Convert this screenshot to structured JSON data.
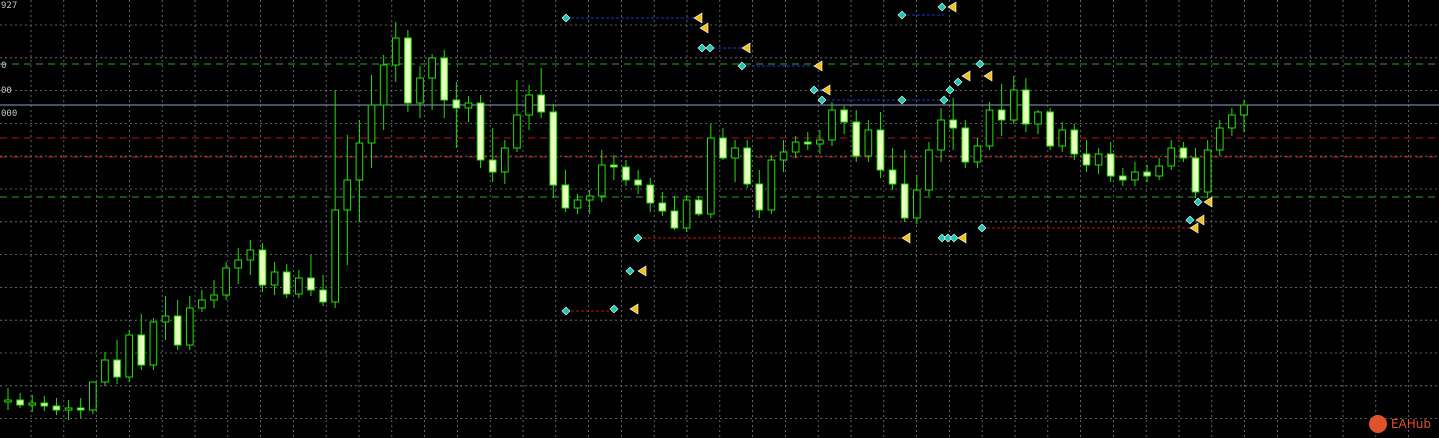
{
  "colors": {
    "background": "#000000",
    "grid": "#7c7c7c",
    "bull": "#22e000",
    "bull_body": "#000000",
    "bear_body": "#e8ffc0",
    "wick": "#22e000",
    "current_line": "#8aa0c8",
    "green_dash": "#2aa02a",
    "red_dash": "#b41414",
    "blue_arrow_line": "#2030d0",
    "red_arrow_line": "#c01010",
    "marker_buy": "#18c8b0",
    "marker_sell": "#f0c020",
    "watermark": "#e0522b"
  },
  "price_labels": [
    "927",
    "0",
    "00",
    "000"
  ],
  "watermark": {
    "text": "EAHub"
  },
  "chart_data": {
    "type": "candlestick",
    "ylim": [
      0,
      438
    ],
    "levels": {
      "current": 105,
      "green_dashed": [
        64,
        197
      ],
      "red_dashed": [
        138,
        157
      ]
    },
    "candles": [
      {
        "o": 402,
        "h": 388,
        "l": 410,
        "c": 400
      },
      {
        "o": 400,
        "h": 393,
        "l": 408,
        "c": 405
      },
      {
        "o": 405,
        "h": 395,
        "l": 412,
        "c": 403
      },
      {
        "o": 403,
        "h": 396,
        "l": 411,
        "c": 406
      },
      {
        "o": 406,
        "h": 398,
        "l": 415,
        "c": 410
      },
      {
        "o": 410,
        "h": 400,
        "l": 420,
        "c": 408
      },
      {
        "o": 408,
        "h": 398,
        "l": 418,
        "c": 410
      },
      {
        "o": 410,
        "h": 394,
        "l": 414,
        "c": 382
      },
      {
        "o": 382,
        "h": 352,
        "l": 386,
        "c": 360
      },
      {
        "o": 360,
        "h": 340,
        "l": 384,
        "c": 377
      },
      {
        "o": 377,
        "h": 330,
        "l": 382,
        "c": 335
      },
      {
        "o": 335,
        "h": 314,
        "l": 370,
        "c": 365
      },
      {
        "o": 365,
        "h": 318,
        "l": 370,
        "c": 322
      },
      {
        "o": 322,
        "h": 296,
        "l": 340,
        "c": 316
      },
      {
        "o": 316,
        "h": 300,
        "l": 350,
        "c": 345
      },
      {
        "o": 345,
        "h": 296,
        "l": 350,
        "c": 308
      },
      {
        "o": 308,
        "h": 290,
        "l": 312,
        "c": 300
      },
      {
        "o": 300,
        "h": 280,
        "l": 308,
        "c": 295
      },
      {
        "o": 295,
        "h": 262,
        "l": 300,
        "c": 268
      },
      {
        "o": 268,
        "h": 248,
        "l": 284,
        "c": 260
      },
      {
        "o": 260,
        "h": 240,
        "l": 275,
        "c": 250
      },
      {
        "o": 250,
        "h": 243,
        "l": 292,
        "c": 285
      },
      {
        "o": 285,
        "h": 262,
        "l": 295,
        "c": 272
      },
      {
        "o": 272,
        "h": 264,
        "l": 298,
        "c": 294
      },
      {
        "o": 294,
        "h": 270,
        "l": 298,
        "c": 278
      },
      {
        "o": 278,
        "h": 255,
        "l": 296,
        "c": 290
      },
      {
        "o": 290,
        "h": 275,
        "l": 306,
        "c": 302
      },
      {
        "o": 302,
        "h": 90,
        "l": 308,
        "c": 210
      },
      {
        "o": 210,
        "h": 135,
        "l": 265,
        "c": 180
      },
      {
        "o": 180,
        "h": 120,
        "l": 222,
        "c": 143
      },
      {
        "o": 143,
        "h": 75,
        "l": 168,
        "c": 105
      },
      {
        "o": 105,
        "h": 55,
        "l": 130,
        "c": 65
      },
      {
        "o": 65,
        "h": 22,
        "l": 82,
        "c": 38
      },
      {
        "o": 38,
        "h": 30,
        "l": 112,
        "c": 103
      },
      {
        "o": 103,
        "h": 66,
        "l": 118,
        "c": 78
      },
      {
        "o": 78,
        "h": 54,
        "l": 110,
        "c": 58
      },
      {
        "o": 58,
        "h": 50,
        "l": 118,
        "c": 100
      },
      {
        "o": 100,
        "h": 82,
        "l": 148,
        "c": 108
      },
      {
        "o": 108,
        "h": 96,
        "l": 122,
        "c": 103
      },
      {
        "o": 103,
        "h": 95,
        "l": 168,
        "c": 160
      },
      {
        "o": 160,
        "h": 128,
        "l": 182,
        "c": 172
      },
      {
        "o": 172,
        "h": 140,
        "l": 184,
        "c": 148
      },
      {
        "o": 148,
        "h": 80,
        "l": 152,
        "c": 115
      },
      {
        "o": 115,
        "h": 85,
        "l": 130,
        "c": 95
      },
      {
        "o": 95,
        "h": 68,
        "l": 118,
        "c": 112
      },
      {
        "o": 112,
        "h": 104,
        "l": 198,
        "c": 185
      },
      {
        "o": 185,
        "h": 170,
        "l": 212,
        "c": 208
      },
      {
        "o": 208,
        "h": 194,
        "l": 214,
        "c": 200
      },
      {
        "o": 200,
        "h": 190,
        "l": 214,
        "c": 196
      },
      {
        "o": 196,
        "h": 150,
        "l": 202,
        "c": 165
      },
      {
        "o": 165,
        "h": 155,
        "l": 180,
        "c": 167
      },
      {
        "o": 167,
        "h": 160,
        "l": 186,
        "c": 180
      },
      {
        "o": 180,
        "h": 170,
        "l": 194,
        "c": 185
      },
      {
        "o": 185,
        "h": 178,
        "l": 212,
        "c": 203
      },
      {
        "o": 203,
        "h": 192,
        "l": 216,
        "c": 211
      },
      {
        "o": 211,
        "h": 196,
        "l": 230,
        "c": 228
      },
      {
        "o": 228,
        "h": 195,
        "l": 232,
        "c": 200
      },
      {
        "o": 200,
        "h": 196,
        "l": 216,
        "c": 214
      },
      {
        "o": 214,
        "h": 124,
        "l": 218,
        "c": 138
      },
      {
        "o": 138,
        "h": 128,
        "l": 160,
        "c": 158
      },
      {
        "o": 158,
        "h": 140,
        "l": 182,
        "c": 148
      },
      {
        "o": 148,
        "h": 140,
        "l": 188,
        "c": 184
      },
      {
        "o": 184,
        "h": 170,
        "l": 218,
        "c": 210
      },
      {
        "o": 210,
        "h": 155,
        "l": 214,
        "c": 160
      },
      {
        "o": 160,
        "h": 140,
        "l": 172,
        "c": 152
      },
      {
        "o": 152,
        "h": 136,
        "l": 158,
        "c": 142
      },
      {
        "o": 142,
        "h": 132,
        "l": 150,
        "c": 144
      },
      {
        "o": 144,
        "h": 130,
        "l": 154,
        "c": 140
      },
      {
        "o": 140,
        "h": 102,
        "l": 146,
        "c": 110
      },
      {
        "o": 110,
        "h": 106,
        "l": 134,
        "c": 122
      },
      {
        "o": 122,
        "h": 110,
        "l": 162,
        "c": 156
      },
      {
        "o": 156,
        "h": 120,
        "l": 162,
        "c": 130
      },
      {
        "o": 130,
        "h": 112,
        "l": 178,
        "c": 170
      },
      {
        "o": 170,
        "h": 148,
        "l": 190,
        "c": 184
      },
      {
        "o": 184,
        "h": 150,
        "l": 222,
        "c": 218
      },
      {
        "o": 218,
        "h": 175,
        "l": 224,
        "c": 190
      },
      {
        "o": 190,
        "h": 142,
        "l": 196,
        "c": 150
      },
      {
        "o": 150,
        "h": 108,
        "l": 162,
        "c": 120
      },
      {
        "o": 120,
        "h": 98,
        "l": 150,
        "c": 128
      },
      {
        "o": 128,
        "h": 120,
        "l": 168,
        "c": 162
      },
      {
        "o": 162,
        "h": 138,
        "l": 168,
        "c": 146
      },
      {
        "o": 146,
        "h": 102,
        "l": 150,
        "c": 110
      },
      {
        "o": 110,
        "h": 84,
        "l": 136,
        "c": 120
      },
      {
        "o": 120,
        "h": 76,
        "l": 124,
        "c": 90
      },
      {
        "o": 90,
        "h": 78,
        "l": 132,
        "c": 124
      },
      {
        "o": 124,
        "h": 110,
        "l": 134,
        "c": 112
      },
      {
        "o": 112,
        "h": 108,
        "l": 150,
        "c": 146
      },
      {
        "o": 146,
        "h": 122,
        "l": 152,
        "c": 130
      },
      {
        "o": 130,
        "h": 124,
        "l": 160,
        "c": 154
      },
      {
        "o": 154,
        "h": 140,
        "l": 172,
        "c": 165
      },
      {
        "o": 165,
        "h": 148,
        "l": 174,
        "c": 154
      },
      {
        "o": 154,
        "h": 142,
        "l": 182,
        "c": 176
      },
      {
        "o": 176,
        "h": 168,
        "l": 186,
        "c": 180
      },
      {
        "o": 180,
        "h": 162,
        "l": 186,
        "c": 172
      },
      {
        "o": 172,
        "h": 165,
        "l": 182,
        "c": 176
      },
      {
        "o": 176,
        "h": 158,
        "l": 180,
        "c": 166
      },
      {
        "o": 166,
        "h": 140,
        "l": 170,
        "c": 148
      },
      {
        "o": 148,
        "h": 142,
        "l": 162,
        "c": 158
      },
      {
        "o": 158,
        "h": 148,
        "l": 198,
        "c": 192
      },
      {
        "o": 192,
        "h": 140,
        "l": 198,
        "c": 150
      },
      {
        "o": 150,
        "h": 120,
        "l": 156,
        "c": 128
      },
      {
        "o": 128,
        "h": 108,
        "l": 136,
        "c": 115
      },
      {
        "o": 115,
        "h": 100,
        "l": 132,
        "c": 105
      }
    ],
    "arrow_lines": [
      {
        "x1": 566,
        "y1": 18,
        "x2": 698,
        "y2": 18,
        "color": "blue"
      },
      {
        "x1": 902,
        "y1": 15,
        "x2": 944,
        "y2": 15,
        "color": "blue"
      },
      {
        "x1": 703,
        "y1": 48,
        "x2": 745,
        "y2": 48,
        "color": "blue"
      },
      {
        "x1": 742,
        "y1": 66,
        "x2": 818,
        "y2": 66,
        "color": "blue"
      },
      {
        "x1": 814,
        "y1": 90,
        "x2": 826,
        "y2": 90,
        "color": "blue"
      },
      {
        "x1": 822,
        "y1": 100,
        "x2": 902,
        "y2": 100,
        "color": "blue"
      },
      {
        "x1": 902,
        "y1": 100,
        "x2": 944,
        "y2": 100,
        "color": "blue"
      },
      {
        "x1": 566,
        "y1": 311,
        "x2": 614,
        "y2": 311,
        "color": "red"
      },
      {
        "x1": 638,
        "y1": 238,
        "x2": 906,
        "y2": 238,
        "color": "red"
      },
      {
        "x1": 982,
        "y1": 228,
        "x2": 1194,
        "y2": 228,
        "color": "red"
      }
    ],
    "markers": [
      {
        "x": 566,
        "y": 18,
        "kind": "buy"
      },
      {
        "x": 698,
        "y": 18,
        "kind": "sell"
      },
      {
        "x": 704,
        "y": 28,
        "kind": "sell"
      },
      {
        "x": 902,
        "y": 15,
        "kind": "buy"
      },
      {
        "x": 942,
        "y": 7,
        "kind": "buy"
      },
      {
        "x": 952,
        "y": 7,
        "kind": "sell"
      },
      {
        "x": 702,
        "y": 48,
        "kind": "buy"
      },
      {
        "x": 710,
        "y": 48,
        "kind": "buy"
      },
      {
        "x": 746,
        "y": 48,
        "kind": "sell"
      },
      {
        "x": 742,
        "y": 66,
        "kind": "buy"
      },
      {
        "x": 818,
        "y": 66,
        "kind": "sell"
      },
      {
        "x": 814,
        "y": 90,
        "kind": "buy"
      },
      {
        "x": 826,
        "y": 90,
        "kind": "sell"
      },
      {
        "x": 822,
        "y": 100,
        "kind": "buy"
      },
      {
        "x": 902,
        "y": 100,
        "kind": "buy"
      },
      {
        "x": 944,
        "y": 100,
        "kind": "buy"
      },
      {
        "x": 950,
        "y": 90,
        "kind": "buy"
      },
      {
        "x": 958,
        "y": 82,
        "kind": "buy"
      },
      {
        "x": 966,
        "y": 76,
        "kind": "sell"
      },
      {
        "x": 980,
        "y": 64,
        "kind": "buy"
      },
      {
        "x": 988,
        "y": 76,
        "kind": "sell"
      },
      {
        "x": 566,
        "y": 311,
        "kind": "buy"
      },
      {
        "x": 614,
        "y": 309,
        "kind": "buy"
      },
      {
        "x": 634,
        "y": 309,
        "kind": "sell"
      },
      {
        "x": 630,
        "y": 271,
        "kind": "buy"
      },
      {
        "x": 642,
        "y": 271,
        "kind": "sell"
      },
      {
        "x": 638,
        "y": 238,
        "kind": "buy"
      },
      {
        "x": 906,
        "y": 238,
        "kind": "sell"
      },
      {
        "x": 942,
        "y": 238,
        "kind": "buy"
      },
      {
        "x": 948,
        "y": 238,
        "kind": "buy"
      },
      {
        "x": 954,
        "y": 238,
        "kind": "buy"
      },
      {
        "x": 962,
        "y": 238,
        "kind": "sell"
      },
      {
        "x": 982,
        "y": 228,
        "kind": "buy"
      },
      {
        "x": 1194,
        "y": 228,
        "kind": "sell"
      },
      {
        "x": 1190,
        "y": 220,
        "kind": "buy"
      },
      {
        "x": 1200,
        "y": 220,
        "kind": "sell"
      },
      {
        "x": 1198,
        "y": 202,
        "kind": "buy"
      },
      {
        "x": 1208,
        "y": 202,
        "kind": "sell"
      }
    ],
    "xlabel": "",
    "ylabel": "",
    "title": "",
    "grid": true
  }
}
